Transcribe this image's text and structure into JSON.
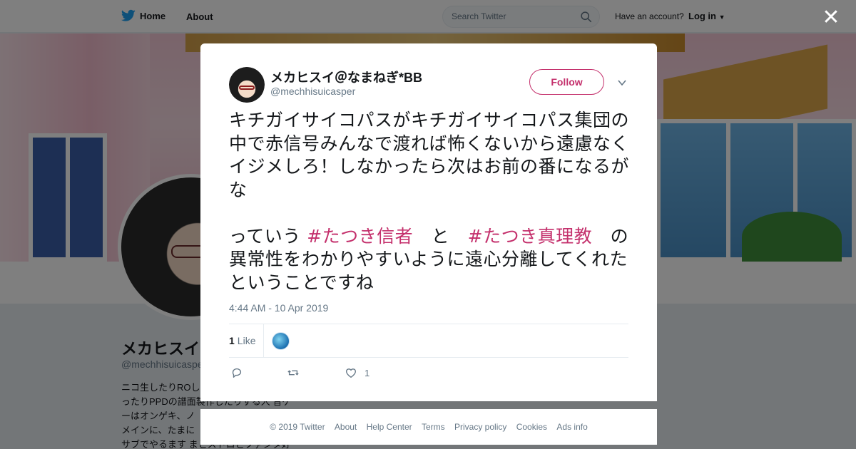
{
  "topbar": {
    "home_label": "Home",
    "about_label": "About",
    "search_placeholder": "Search Twitter",
    "have_account": "Have an account?",
    "login_label": "Log in"
  },
  "profile": {
    "name": "メカヒスイ",
    "handle": "@mechhisuicasper",
    "bio_lines": [
      "ニコ生したりROし",
      "ったりPPDの譜面製作したりする人 音ゲ",
      "ーはオンゲキ、ノ",
      "メインに、たまに",
      "サブでやるます まとストロとファンタ好"
    ]
  },
  "tweet": {
    "author_name": "メカヒスイ＠なまねぎ*BB",
    "author_handle": "@mechhisuicasper",
    "follow_label": "Follow",
    "text_para1": "キチガイサイコパスがキチガイサイコパス集団の中で赤信号みんなで渡れば怖くないから遠慮なくイジメしろ！しなかったら次はお前の番になるがな",
    "text_p2_pre": "っていう ",
    "hashtag1": "#たつき信者",
    "text_p2_mid": "　と　",
    "hashtag2": "#たつき真理教",
    "text_p2_post": "　の異常性をわかりやすいように遠心分離してくれたということですね",
    "timestamp": "4:44 AM - 10 Apr 2019",
    "likes_count": "1",
    "likes_label": "Like",
    "action_like_count": "1"
  },
  "footer": {
    "links": [
      "© 2019 Twitter",
      "About",
      "Help Center",
      "Terms",
      "Privacy policy",
      "Cookies",
      "Ads info"
    ]
  },
  "colors": {
    "accent": "#c4306c",
    "twitter_blue": "#1da1f2",
    "muted": "#657786"
  }
}
